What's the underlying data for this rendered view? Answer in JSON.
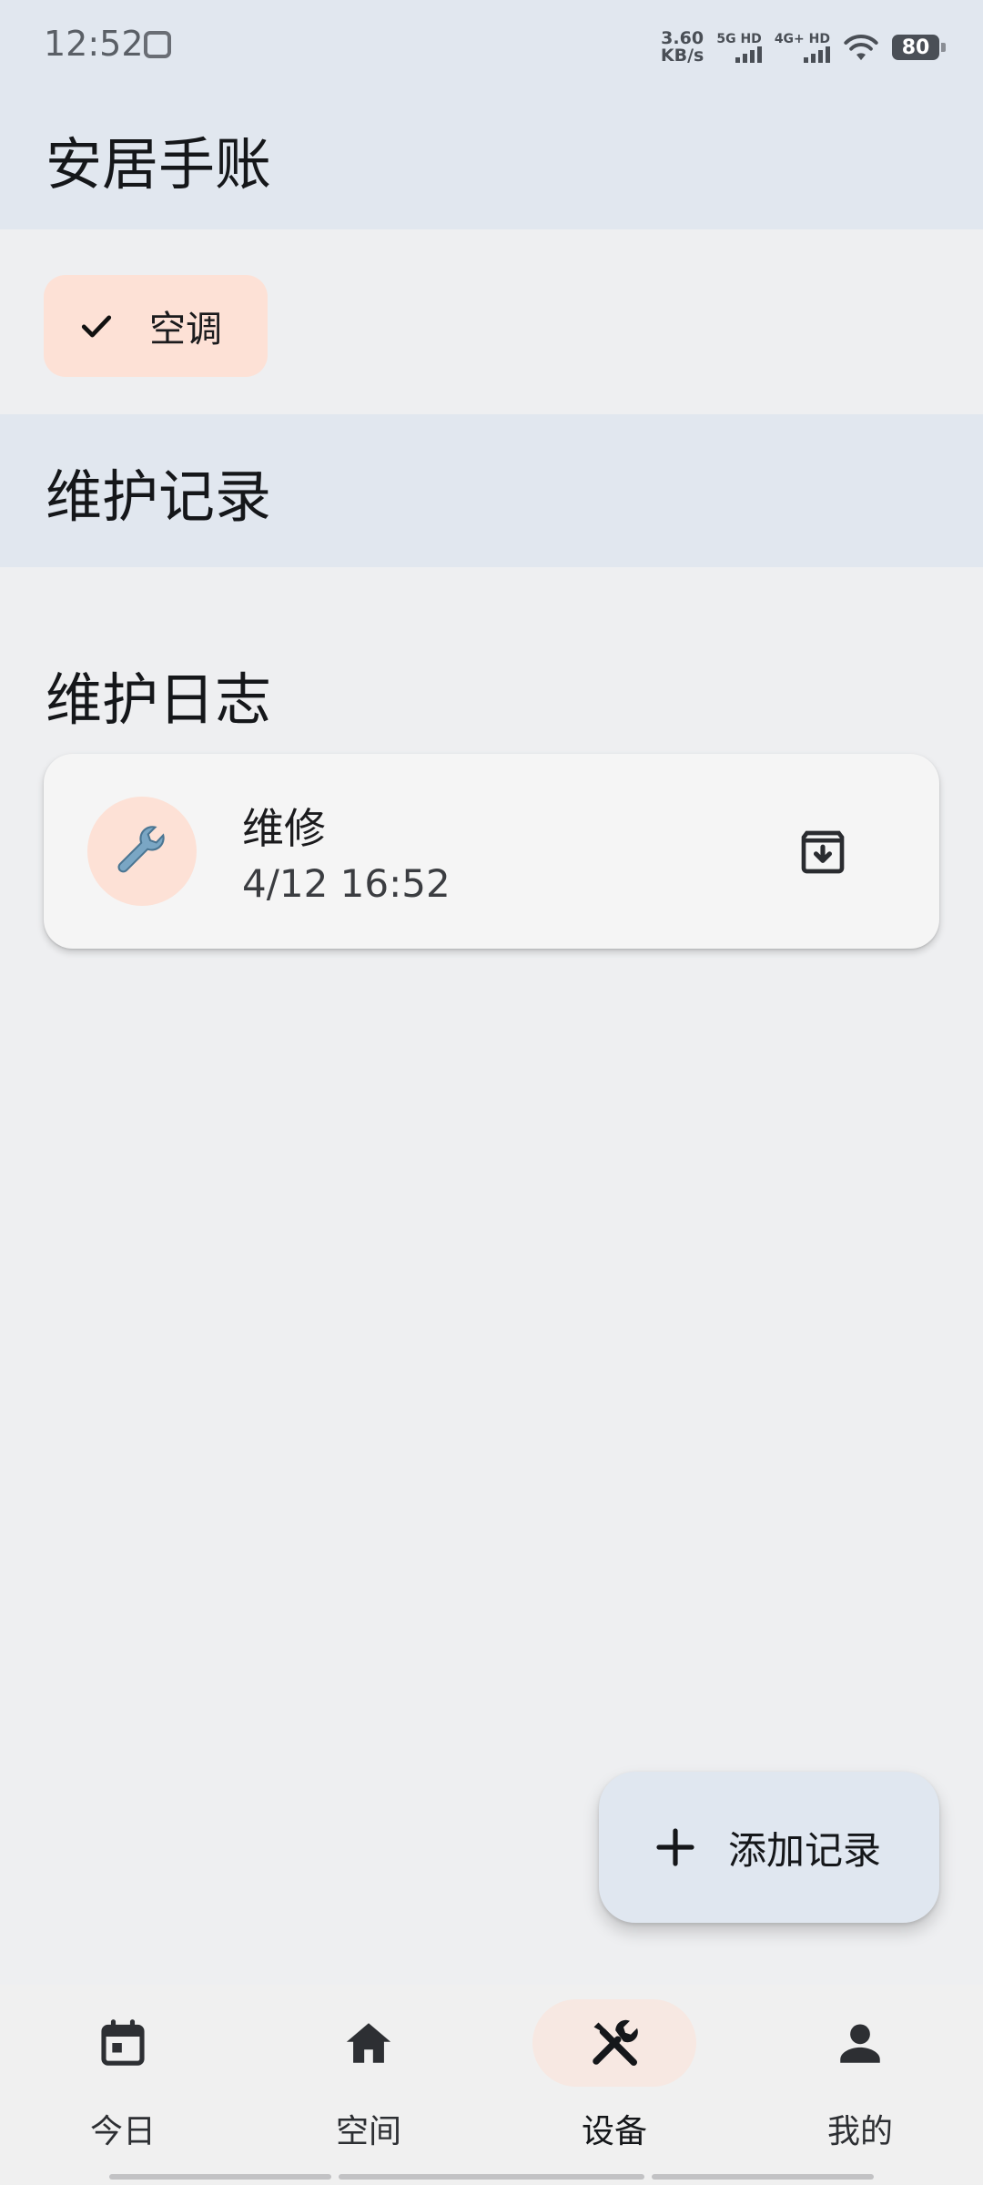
{
  "status_bar": {
    "time": "12:52",
    "net_speed_value": "3.60",
    "net_speed_unit": "KB/s",
    "sim1_label": "5G HD",
    "sim2_label": "4G+ HD",
    "battery": "80",
    "icons": [
      "app-notification-icon",
      "wifi-icon",
      "battery-icon"
    ]
  },
  "app_bar": {
    "title": "安居手账"
  },
  "filter_chip": {
    "label": "空调",
    "selected": true,
    "icon": "check-icon"
  },
  "section": {
    "title": "维护记录"
  },
  "log_section": {
    "title": "维护日志"
  },
  "log_items": [
    {
      "icon": "wrench-icon",
      "title": "维修",
      "time": "4/12 16:52",
      "action_icon": "archive-icon"
    }
  ],
  "fab": {
    "label": "添加记录",
    "icon": "plus-icon"
  },
  "bottom_nav": {
    "items": [
      {
        "label": "今日",
        "icon": "calendar-icon",
        "active": false
      },
      {
        "label": "空间",
        "icon": "home-icon",
        "active": false
      },
      {
        "label": "设备",
        "icon": "tools-icon",
        "active": true
      },
      {
        "label": "我的",
        "icon": "person-icon",
        "active": false
      }
    ]
  },
  "colors": {
    "header_bg": "#e1e7ef",
    "page_bg": "#eeeff1",
    "chip_bg": "#fde1d6",
    "card_bg": "#f5f5f5",
    "fab_bg": "#e0e7f0",
    "nav_active_bg": "#f7e8e2"
  }
}
